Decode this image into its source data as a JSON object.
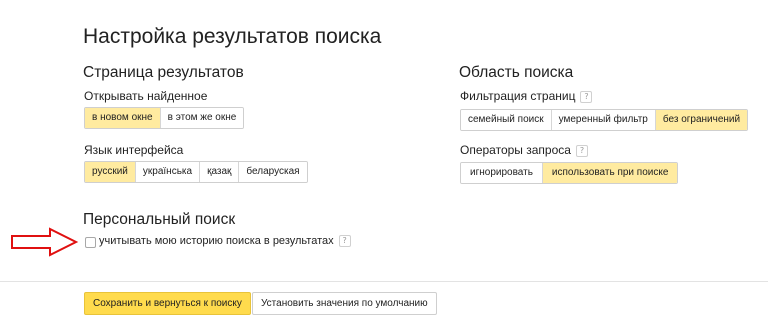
{
  "page_title": "Настройка результатов поиска",
  "results_page": {
    "title": "Страница результатов",
    "open_found": {
      "label": "Открывать найденное",
      "options": [
        "в новом окне",
        "в этом же окне"
      ],
      "selected": "в новом окне"
    },
    "interface_language": {
      "label": "Язык интерфейса",
      "options": [
        "русский",
        "українська",
        "қазақ",
        "беларуская"
      ],
      "selected": "русский"
    }
  },
  "search_area": {
    "title": "Область поиска",
    "page_filter": {
      "label": "Фильтрация страниц",
      "help": "?",
      "options": [
        "семейный поиск",
        "умеренный фильтр",
        "без ограничений"
      ],
      "selected": "без ограничений"
    },
    "query_operators": {
      "label": "Операторы запроса",
      "help": "?",
      "options": [
        "игнорировать",
        "использовать при поиске"
      ],
      "selected": "использовать при поиске"
    }
  },
  "personal_search": {
    "title": "Персональный поиск",
    "history_checkbox": {
      "label": "учитывать мою историю поиска в результатах",
      "help": "?",
      "checked": false
    }
  },
  "footer": {
    "save_label": "Сохранить и вернуться к поиску",
    "defaults_label": "Установить значения по умолчанию"
  },
  "colors": {
    "active_segment": "#ffeba0",
    "primary_button": "#ffdb4d",
    "annotation_arrow": "#e01010"
  }
}
